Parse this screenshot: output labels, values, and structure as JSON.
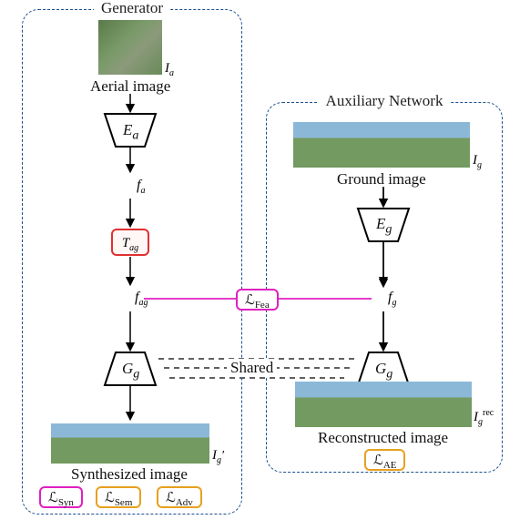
{
  "groups": {
    "generator_title": "Generator",
    "aux_title": "Auxiliary Network"
  },
  "labels": {
    "aerial_caption": "Aerial image",
    "ground_caption": "Ground image",
    "synth_caption": "Synthesized image",
    "recon_caption": "Reconstructed image",
    "shared": "Shared"
  },
  "symbols": {
    "Ea": "E",
    "Ea_sub": "a",
    "fa": "f",
    "fa_sub": "a",
    "Tag": "T",
    "Tag_sub": "ag",
    "fag": "f",
    "fag_sub": "ag",
    "Eg": "E",
    "Eg_sub": "g",
    "fg": "f",
    "fg_sub": "g",
    "Gg": "G",
    "Gg_sub": "g",
    "Ia": "I",
    "Ia_sub": "a",
    "Ig": "I",
    "Ig_sub": "g",
    "Igp": "I",
    "Igp_sub": "g",
    "Igp_sup": "′",
    "Igrec": "I",
    "Igrec_sub": "g",
    "Igrec_sup": "rec"
  },
  "losses": {
    "fea": "ℒ",
    "fea_sub": "Fea",
    "syn": "ℒ",
    "syn_sub": "Syn",
    "sem": "ℒ",
    "sem_sub": "Sem",
    "adv": "ℒ",
    "adv_sub": "Adv",
    "ae": "ℒ",
    "ae_sub": "AE"
  }
}
